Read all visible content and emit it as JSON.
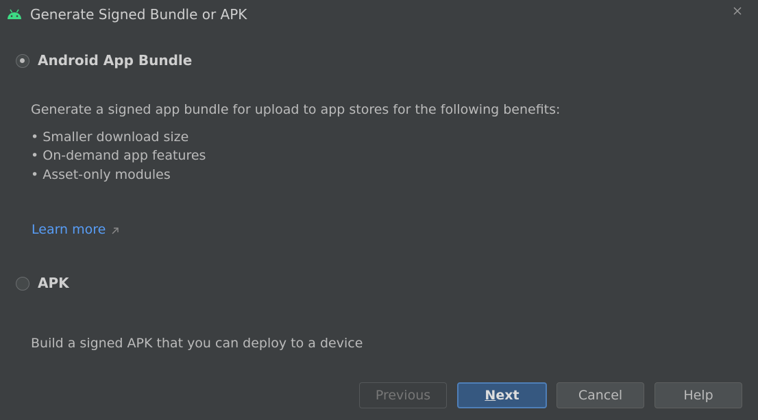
{
  "dialog": {
    "title": "Generate Signed Bundle or APK",
    "icon": "android-icon",
    "close_icon": "close-icon"
  },
  "options": {
    "bundle": {
      "label": "Android App Bundle",
      "selected": true,
      "description": "Generate a signed app bundle for upload to app stores for the following benefits:",
      "bullets": [
        "• Smaller download size",
        "• On-demand app features",
        "• Asset-only modules"
      ],
      "link_text": "Learn more",
      "link_icon": "external-link-arrow-icon"
    },
    "apk": {
      "label": "APK",
      "selected": false,
      "description": "Build a signed APK that you can deploy to a device"
    }
  },
  "buttons": {
    "previous": "Previous",
    "next_mnemonic": "N",
    "next_rest": "ext",
    "cancel": "Cancel",
    "help": "Help"
  },
  "colors": {
    "background": "#3c3f41",
    "link": "#589df6",
    "primary_button": "#365880",
    "android_green": "#3ddc84"
  }
}
